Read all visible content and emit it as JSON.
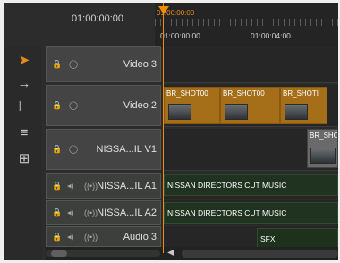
{
  "header": {
    "timecode": "01:00:00:00",
    "ruler_playhead_tc": "01:00:00:00",
    "ruler_labels": [
      "01:00:00:00",
      "01:00:04:00"
    ]
  },
  "tracks": [
    {
      "name": "Video 3",
      "type": "video"
    },
    {
      "name": "Video 2",
      "type": "video"
    },
    {
      "name": "NISSA...IL V1",
      "type": "video"
    },
    {
      "name": "NISSA...IL A1",
      "type": "audio"
    },
    {
      "name": "NISSA...IL A2",
      "type": "audio"
    },
    {
      "name": "Audio 3",
      "type": "audio"
    }
  ],
  "clips": {
    "video2": [
      "BR_SHOT00",
      "BR_SHOT00",
      "BR_SHOTI"
    ],
    "v1": "BR_SHO",
    "a1": "NISSAN DIRECTORS CUT MUSIC",
    "a2": "NISSAN DIRECTORS CUT MUSIC",
    "a3": "SFX"
  },
  "icons": {
    "tool_select": "selection-tool-icon",
    "tool_track_select": "track-select-tool-icon",
    "tool_ripple": "ripple-edit-tool-icon",
    "tool_rolling": "rolling-edit-tool-icon",
    "tool_slip": "slip-tool-icon",
    "lock": "lock-icon",
    "eye": "eye-icon",
    "speaker": "speaker-icon",
    "radio": "broadcast-icon"
  },
  "colors": {
    "accent_playhead": "#f08c00",
    "clip_video": "#a56f19",
    "clip_audio": "#1f3320"
  }
}
